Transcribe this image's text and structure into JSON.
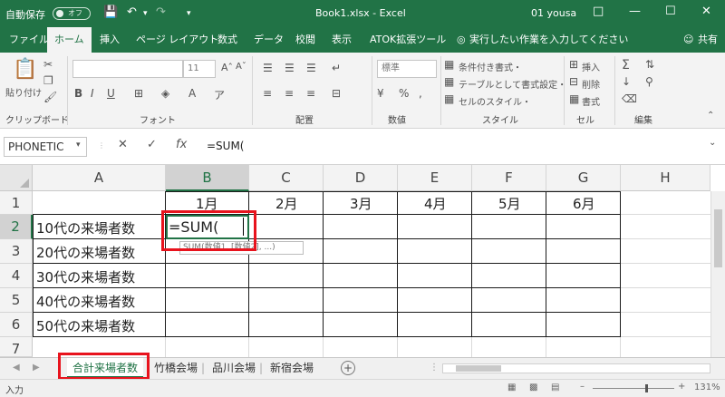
{
  "titlebar": {
    "autosave_label": "自動保存",
    "autosave_state": "オフ",
    "doc_title": "Book1.xlsx - Excel",
    "user": "01 yousa",
    "icons": [
      "save-icon",
      "undo-icon",
      "redo-icon",
      "customize-icon",
      "ribbon-display-icon",
      "minimize-icon",
      "maximize-icon",
      "close-icon"
    ]
  },
  "tabs": [
    {
      "label": "ファイル"
    },
    {
      "label": "ホーム"
    },
    {
      "label": "挿入"
    },
    {
      "label": "ページ レイアウト"
    },
    {
      "label": "数式"
    },
    {
      "label": "データ"
    },
    {
      "label": "校閲"
    },
    {
      "label": "表示"
    },
    {
      "label": "ATOK拡張ツール"
    }
  ],
  "tellme": "実行したい作業を入力してください",
  "share": "共有",
  "ribbon": {
    "paste_label": "貼り付け",
    "font_size": "11",
    "bold": "B",
    "italic": "I",
    "underline": "U",
    "number_format": "標準",
    "conditional": "条件付き書式・",
    "table_format": "テーブルとして書式設定・",
    "cell_style": "セルのスタイル・",
    "insert": "挿入",
    "delete": "削除",
    "format": "書式",
    "groups": {
      "clipboard": "クリップボード",
      "font": "フォント",
      "alignment": "配置",
      "number": "数値",
      "style": "スタイル",
      "cells": "セル",
      "edit": "編集"
    }
  },
  "formula_bar": {
    "name_box": "PHONETIC",
    "fx": "fx",
    "content": "=SUM("
  },
  "sheet": {
    "columns": [
      "A",
      "B",
      "C",
      "D",
      "E",
      "F",
      "G",
      "H"
    ],
    "rows": [
      "1",
      "2",
      "3",
      "4",
      "5",
      "6",
      "7"
    ],
    "months": [
      "1月",
      "2月",
      "3月",
      "4月",
      "5月",
      "6月"
    ],
    "labels": [
      "10代の来場者数",
      "20代の来場者数",
      "30代の来場者数",
      "40代の来場者数",
      "50代の来場者数"
    ],
    "editing": "=SUM(",
    "tooltip": "SUM(数値1, [数値2], ...)"
  },
  "sheet_tabs": [
    "合計来場者数",
    "竹橋会場",
    "品川会場",
    "新宿会場"
  ],
  "status": {
    "mode": "入力",
    "zoom": "131%"
  }
}
